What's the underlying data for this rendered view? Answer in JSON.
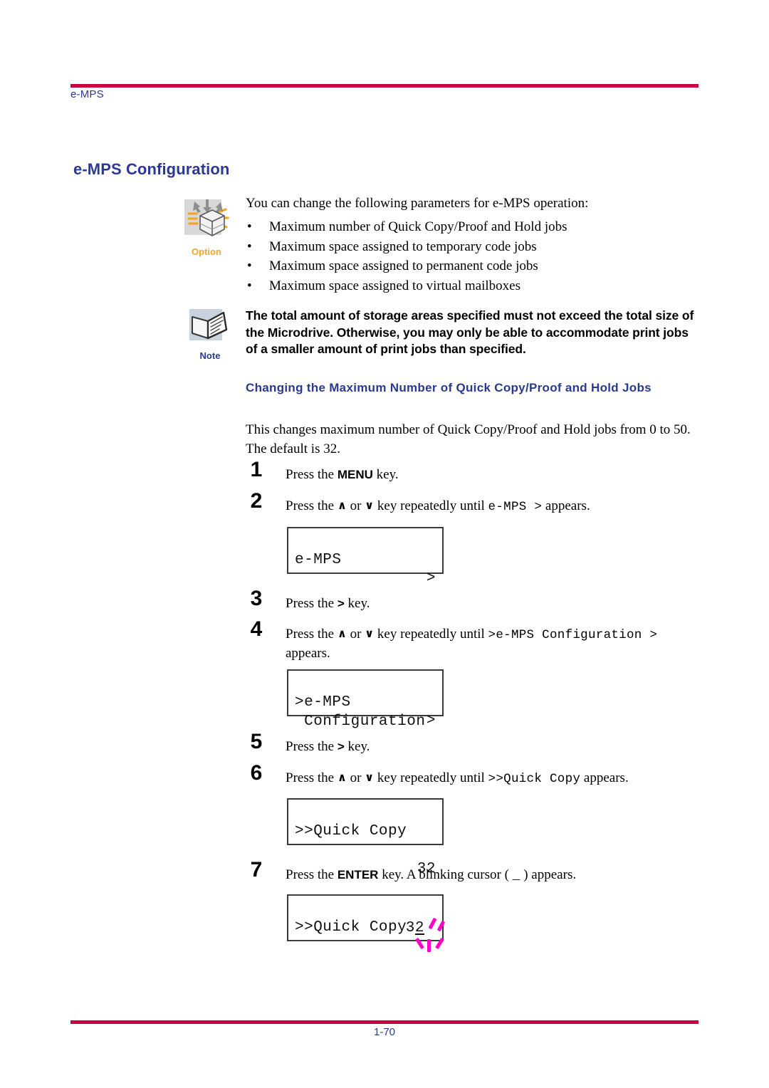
{
  "header": {
    "running_head": "e-MPS",
    "rule_color": "#C8003C",
    "text_color": "#2B3990"
  },
  "section": {
    "title": "e-MPS Configuration"
  },
  "icons": {
    "option": {
      "caption": "Option",
      "icon": "option-cube-icon",
      "color": "#F5A623"
    },
    "note": {
      "caption": "Note",
      "icon": "note-booklet-icon",
      "color": "#2B3990"
    }
  },
  "intro": {
    "paragraph": "You can change the following parameters for e-MPS operation:",
    "bullet_marker": "•",
    "bullets": [
      "Maximum number of Quick Copy/Proof and Hold jobs",
      "Maximum space assigned to temporary code jobs",
      "Maximum space assigned to permanent code jobs",
      "Maximum space assigned to virtual mailboxes"
    ]
  },
  "note": {
    "paragraph": "The total amount of storage areas specified must not exceed the total size of the Microdrive. Otherwise, you may only be able to accommodate print jobs of a smaller amount of print jobs than specified."
  },
  "subsection": {
    "heading": "Changing the Maximum Number of Quick Copy/Proof and Hold Jobs",
    "paragraph": "This changes maximum number of Quick Copy/Proof and Hold jobs from 0 to 50. The default is 32."
  },
  "steps": [
    {
      "number": "1",
      "prefix": "Press the ",
      "key": "MENU",
      "suffix": " key."
    },
    {
      "number": "2",
      "prefix": "Press the ",
      "up": "∧",
      "mid": " or ",
      "down": "∨",
      "suffix": " key repeatedly until ",
      "mono": "e-MPS  >",
      "tail": " appears."
    },
    {
      "number": "3",
      "prefix": "Press the ",
      "key": ">",
      "suffix": " key."
    },
    {
      "number": "4",
      "prefix": "Press the ",
      "up": "∧",
      "mid": " or ",
      "down": "∨",
      "suffix": " key repeatedly until ",
      "mono": ">e-MPS Configuration >",
      "tail": " appears."
    },
    {
      "number": "5",
      "prefix": "Press the ",
      "key": ">",
      "suffix": " key."
    },
    {
      "number": "6",
      "prefix": "Press the ",
      "up": "∧",
      "mid": " or ",
      "down": "∨",
      "suffix": " key repeatedly until ",
      "mono": ">>Quick Copy",
      "tail": " appears."
    },
    {
      "number": "7",
      "prefix": "Press the ",
      "key": "ENTER",
      "suffix": " key. A blinking cursor ( ",
      "cursor_glyph": "_",
      "tail": " ) appears."
    }
  ],
  "displays": [
    {
      "name": "display-e-mps",
      "line1_left": "e-MPS",
      "line1_right": ">",
      "line2_left": "",
      "line2_right": ""
    },
    {
      "name": "display-e-mps-configuration",
      "line1_left": ">e-MPS",
      "line1_right": ">",
      "line2_left": " Configuration",
      "line2_right": ""
    },
    {
      "name": "display-quick-copy-value",
      "line1_left": ">>Quick Copy",
      "line1_right": "",
      "line2_left": "",
      "line2_right": "32"
    },
    {
      "name": "display-quick-copy-blinking",
      "line1_left": ">>Quick Copy",
      "line1_right": "",
      "line2_left": "",
      "line2_right": "32",
      "blink_color": "#FF00C8"
    }
  ],
  "footer": {
    "page_number": "1-70",
    "rule_color": "#C8003C",
    "text_color": "#2B3990"
  }
}
